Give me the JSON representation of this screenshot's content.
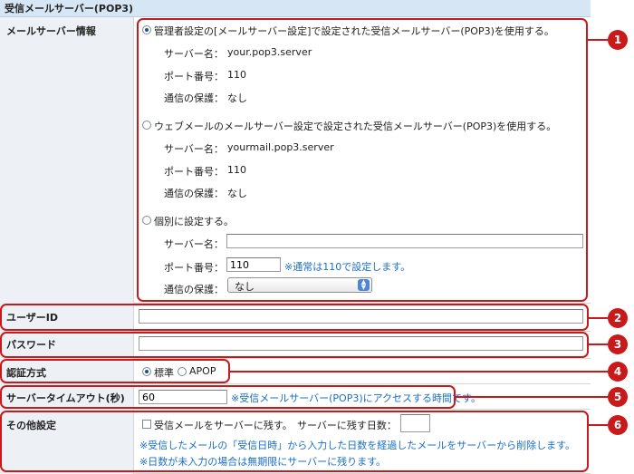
{
  "section_title": "受信メールサーバー(POP3)",
  "mail_server": {
    "label": "メールサーバー情報",
    "option_admin": {
      "label": "管理者設定の[メールサーバー設定]で設定された受信メールサーバー(POP3)を使用する。",
      "selected": true,
      "server_label": "サーバー名：",
      "server_value": "your.pop3.server",
      "port_label": "ポート番号：",
      "port_value": "110",
      "security_label": "通信の保護：",
      "security_value": "なし"
    },
    "option_webmail": {
      "label": "ウェブメールのメールサーバー設定で設定された受信メールサーバー(POP3)を使用する。",
      "selected": false,
      "server_label": "サーバー名：",
      "server_value": "yourmail.pop3.server",
      "port_label": "ポート番号：",
      "port_value": "110",
      "security_label": "通信の保護：",
      "security_value": "なし"
    },
    "option_custom": {
      "label": "個別に設定する。",
      "selected": false,
      "server_label": "サーバー名：",
      "server_value": "",
      "port_label": "ポート番号：",
      "port_value": "110",
      "port_hint": "※通常は110で設定します。",
      "security_label": "通信の保護：",
      "security_value": "なし"
    }
  },
  "user_id": {
    "label": "ユーザーID",
    "value": ""
  },
  "password": {
    "label": "パスワード",
    "value": ""
  },
  "auth": {
    "label": "認証方式",
    "option_standard": "標準",
    "option_apop": "APOP",
    "selected": "標準"
  },
  "timeout": {
    "label": "サーバータイムアウト(秒)",
    "value": "60",
    "hint": "※受信メールサーバー(POP3)にアクセスする時間です。"
  },
  "other": {
    "label": "その他設定",
    "keep_label": "受信メールをサーバーに残す。",
    "days_label": "サーバーに残す日数：",
    "keep_checked": false,
    "days_value": "",
    "note1": "※受信したメールの「受信日時」から入力した日数を経過したメールをサーバーから削除します。",
    "note2": "※日数が未入力の場合は無期限にサーバーに残ります。"
  },
  "callouts": [
    "1",
    "2",
    "3",
    "4",
    "5",
    "6"
  ],
  "colors": {
    "accent_red": "#c81a1a",
    "header_bg": "#d7e6f4",
    "label_bg": "#edf1f6",
    "hint_blue": "#1a6fc4"
  }
}
